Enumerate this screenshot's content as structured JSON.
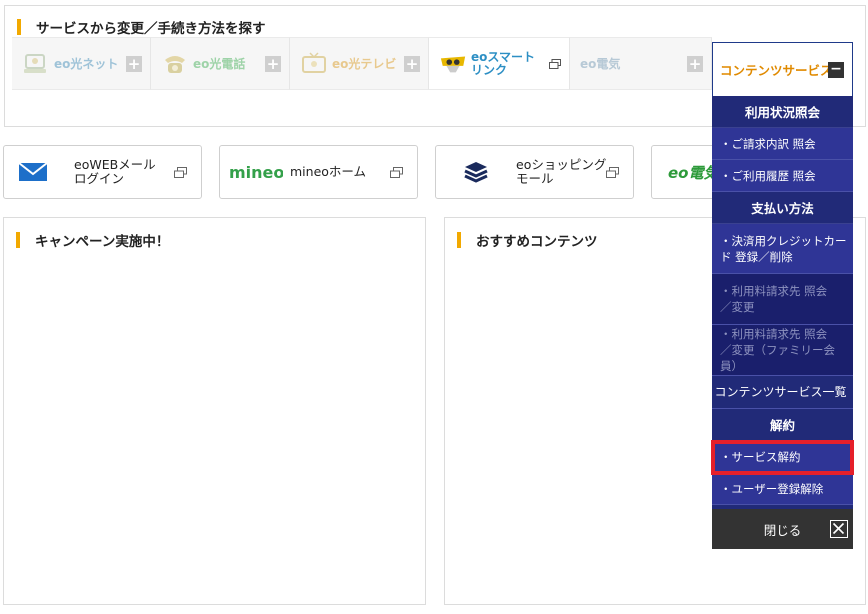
{
  "search_panel": {
    "title": "サービスから変更／手続き方法を探す",
    "tabs": [
      {
        "label": "eo光ネット",
        "icon": "pc-monitor-icon"
      },
      {
        "label": "eo光電話",
        "icon": "telephone-icon"
      },
      {
        "label": "eo光テレビ",
        "icon": "tv-icon"
      },
      {
        "label_line1": "eoスマート",
        "label_line2": "リンク",
        "icon": "smart-link-icon"
      },
      {
        "label": "eo電気",
        "icon": "none"
      }
    ],
    "content_tab": {
      "label": "コンテンツサービス"
    }
  },
  "shortcuts": [
    {
      "label_line1": "eoWEBメール",
      "label_line2": "ログイン",
      "icon": "mail-envelope-icon"
    },
    {
      "label_line1": "mineoホーム",
      "label_line2": "",
      "logo": "mineo"
    },
    {
      "label_line1": "eoショッピング",
      "label_line2": "モール",
      "icon": "layers-stack-icon"
    },
    {
      "logo": "eo電気"
    }
  ],
  "panels": {
    "campaign_title": "キャンペーン実施中！",
    "recommend_title": "おすすめコンテンツ"
  },
  "dropdown": {
    "sections": [
      {
        "title": "利用状況照会",
        "items": [
          {
            "label": "・ご請求内訳 照会"
          },
          {
            "label": "・ご利用履歴 照会"
          }
        ]
      },
      {
        "title": "支払い方法",
        "items": [
          {
            "line1": "・決済用クレジットカー",
            "line2": "ド 登録／削除"
          },
          {
            "line1": "・利用料請求先 照会",
            "line2": "／変更"
          },
          {
            "line1": "・利用料請求先 照会",
            "line2": "／変更（ファミリー会員）"
          }
        ]
      }
    ],
    "list_link": "コンテンツサービス一覧",
    "cancel_section": {
      "title": "解約",
      "items": [
        {
          "label": "・サービス解約"
        },
        {
          "label": "・ユーザー登録解除"
        }
      ]
    },
    "close_label": "閉じる"
  },
  "colors": {
    "accent_bar": "#f2a900",
    "menu_bg": "#212a78",
    "menu_item_bg": "#2f3596",
    "highlight_red": "#e5202a",
    "content_tab_text": "#e08a00"
  }
}
